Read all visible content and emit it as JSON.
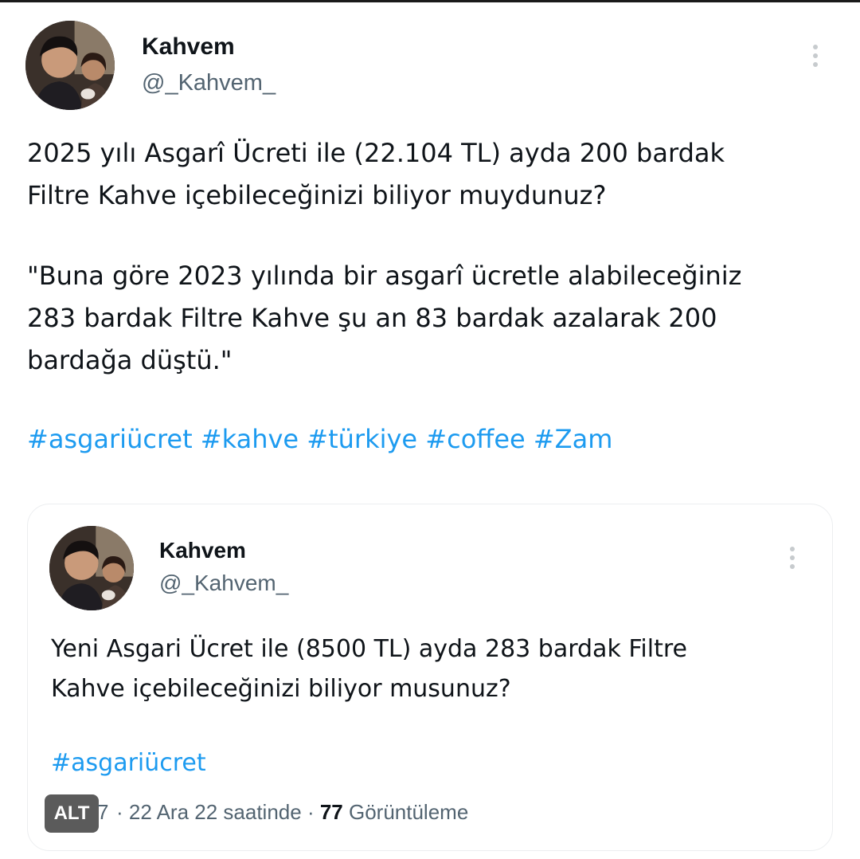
{
  "main_tweet": {
    "author_name": "Kahvem",
    "author_handle": "@_Kahvem_",
    "body_lines": [
      "2025 yılı Asgarî Ücreti ile (22.104 TL) ayda 200 bardak",
      "Filtre Kahve içebileceğinizi biliyor muydunuz?"
    ],
    "quote_lines": [
      "\"Buna göre 2023 yılında bir asgarî ücretle alabileceğiniz",
      "283 bardak Filtre Kahve şu an 83 bardak azalarak 200",
      "bardağa düştü.\""
    ],
    "hashtags": [
      "#asgariücret",
      "#kahve",
      "#türkiye",
      "#coffee",
      "#Zam"
    ]
  },
  "quoted_tweet": {
    "author_name": "Kahvem",
    "author_handle": "@_Kahvem_",
    "body_lines": [
      "Yeni Asgari Ücret ile (8500 TL) ayda 283 bardak Filtre",
      "Kahve içebileceğinizi biliyor musunuz?"
    ],
    "hashtags": [
      "#asgariücret"
    ],
    "alt_badge": "ALT",
    "meta_prefix": "7",
    "meta_date": " · 22 Ara 22 saatinde · ",
    "view_count": "77",
    "view_label": " Görüntüleme"
  },
  "colors": {
    "link": "#1d9bf0",
    "secondary_text": "#536471",
    "primary_text": "#0f1419"
  },
  "icons": {
    "more": "more-vertical-icon"
  }
}
